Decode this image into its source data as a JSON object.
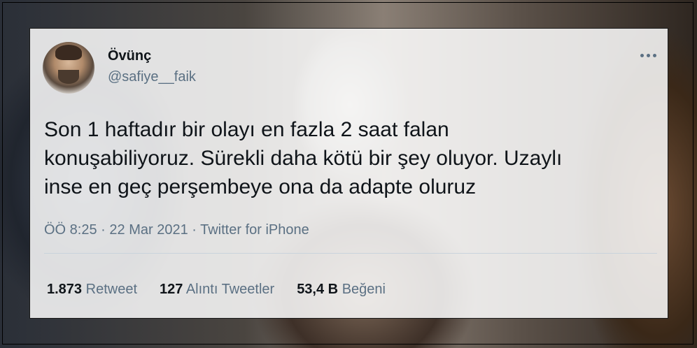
{
  "tweet": {
    "author": {
      "display_name": "Övünç",
      "handle": "@safiye__faik"
    },
    "text_lines": [
      "Son 1 haftadır bir olayı en fazla 2 saat falan",
      "konuşabiliyoruz. Sürekli daha kötü bir şey oluyor. Uzaylı",
      "inse en geç perşembeye ona da adapte oluruz"
    ],
    "time": "ÖÖ 8:25",
    "separator": " · ",
    "date": "22 Mar 2021",
    "source": "Twitter for iPhone",
    "stats": {
      "retweets_count": "1.873",
      "retweets_label": "Retweet",
      "quotes_count": "127",
      "quotes_label": "Alıntı Tweetler",
      "likes_count": "53,4 B",
      "likes_label": "Beğeni"
    },
    "more_icon": "more-horizontal-icon"
  }
}
